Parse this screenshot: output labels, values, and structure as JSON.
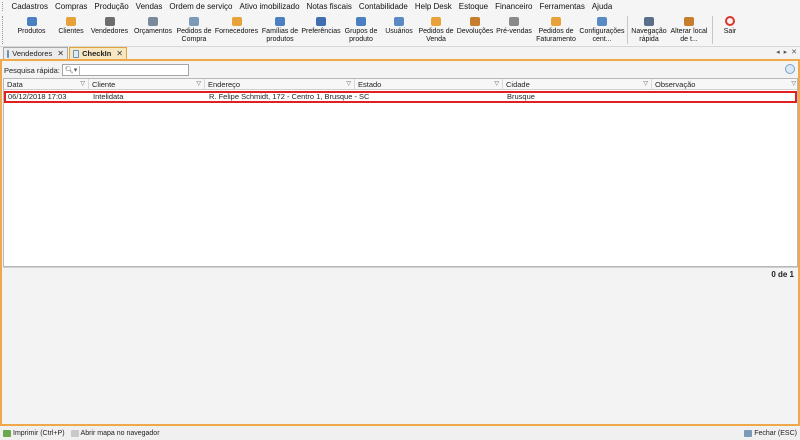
{
  "menu": [
    "Cadastros",
    "Compras",
    "Produção",
    "Vendas",
    "Ordem de serviço",
    "Ativo imobilizado",
    "Notas fiscais",
    "Contabilidade",
    "Help Desk",
    "Estoque",
    "Financeiro",
    "Ferramentas",
    "Ajuda"
  ],
  "toolbar": [
    {
      "label": "Produtos",
      "icon": "box-icon",
      "color": "#4a7fc1"
    },
    {
      "label": "Clientes",
      "icon": "person-icon",
      "color": "#e8a23a"
    },
    {
      "label": "Vendedores",
      "icon": "briefcase-icon",
      "color": "#6d6d6d"
    },
    {
      "label": "Orçamentos",
      "icon": "calculator-icon",
      "color": "#7a8a9a"
    },
    {
      "label": "Pedidos de\nCompra",
      "icon": "cart-icon",
      "color": "#7a9ab8"
    },
    {
      "label": "Fornecedores",
      "icon": "truck-icon",
      "color": "#e8a23a"
    },
    {
      "label": "Famílias de\nprodutos",
      "icon": "boxes-icon",
      "color": "#4a7fc1"
    },
    {
      "label": "Preferências",
      "icon": "wrench-icon",
      "color": "#3f6fb0"
    },
    {
      "label": "Grupos de\nproduto",
      "icon": "group-icon",
      "color": "#4a7fc1"
    },
    {
      "label": "Usuários",
      "icon": "users-icon",
      "color": "#5a8ac6"
    },
    {
      "label": "Pedidos de\nVenda",
      "icon": "cart-sale-icon",
      "color": "#e8a23a"
    },
    {
      "label": "Devoluções",
      "icon": "return-icon",
      "color": "#c77d2e"
    },
    {
      "label": "Pré-vendas",
      "icon": "cart-pre-icon",
      "color": "#8a8a8a"
    },
    {
      "label": "Pedidos de\nFaturamento",
      "icon": "invoice-cart-icon",
      "color": "#e8a23a"
    },
    {
      "label": "Configurações\ncent...",
      "icon": "config-icon",
      "color": "#5a8ac6"
    },
    {
      "label": "Navegação\nrápida",
      "icon": "binoculars-icon",
      "color": "#5a6f8a"
    },
    {
      "label": "Alterar local\nde t...",
      "icon": "home-icon",
      "color": "#c77d2e"
    },
    {
      "label": "Sair",
      "icon": "power-icon",
      "color": "#d9362b"
    }
  ],
  "tabs": [
    {
      "label": "Vendedores",
      "active": false
    },
    {
      "label": "CheckIn",
      "active": true
    }
  ],
  "search": {
    "label": "Pesquisa rápida:",
    "value": "",
    "placeholder": ""
  },
  "columns": [
    "Data",
    "Cliente",
    "Endereço",
    "Estado",
    "Cidade",
    "Observação"
  ],
  "rows": [
    {
      "data": "06/12/2018 17:03",
      "cliente": "Intelidata",
      "endereco": "R. Felipe Schmidt, 172 - Centro 1, Brusque - S...",
      "estado": "SC",
      "cidade": "Brusque",
      "observacao": ""
    }
  ],
  "count": "0 de 1",
  "status": {
    "print": "Imprimir (Ctrl+P)",
    "map": "Abrir mapa no navegador",
    "close": "Fechar (ESC)"
  },
  "colors": {
    "accent": "#f0a94a",
    "selection": "#e12020"
  }
}
